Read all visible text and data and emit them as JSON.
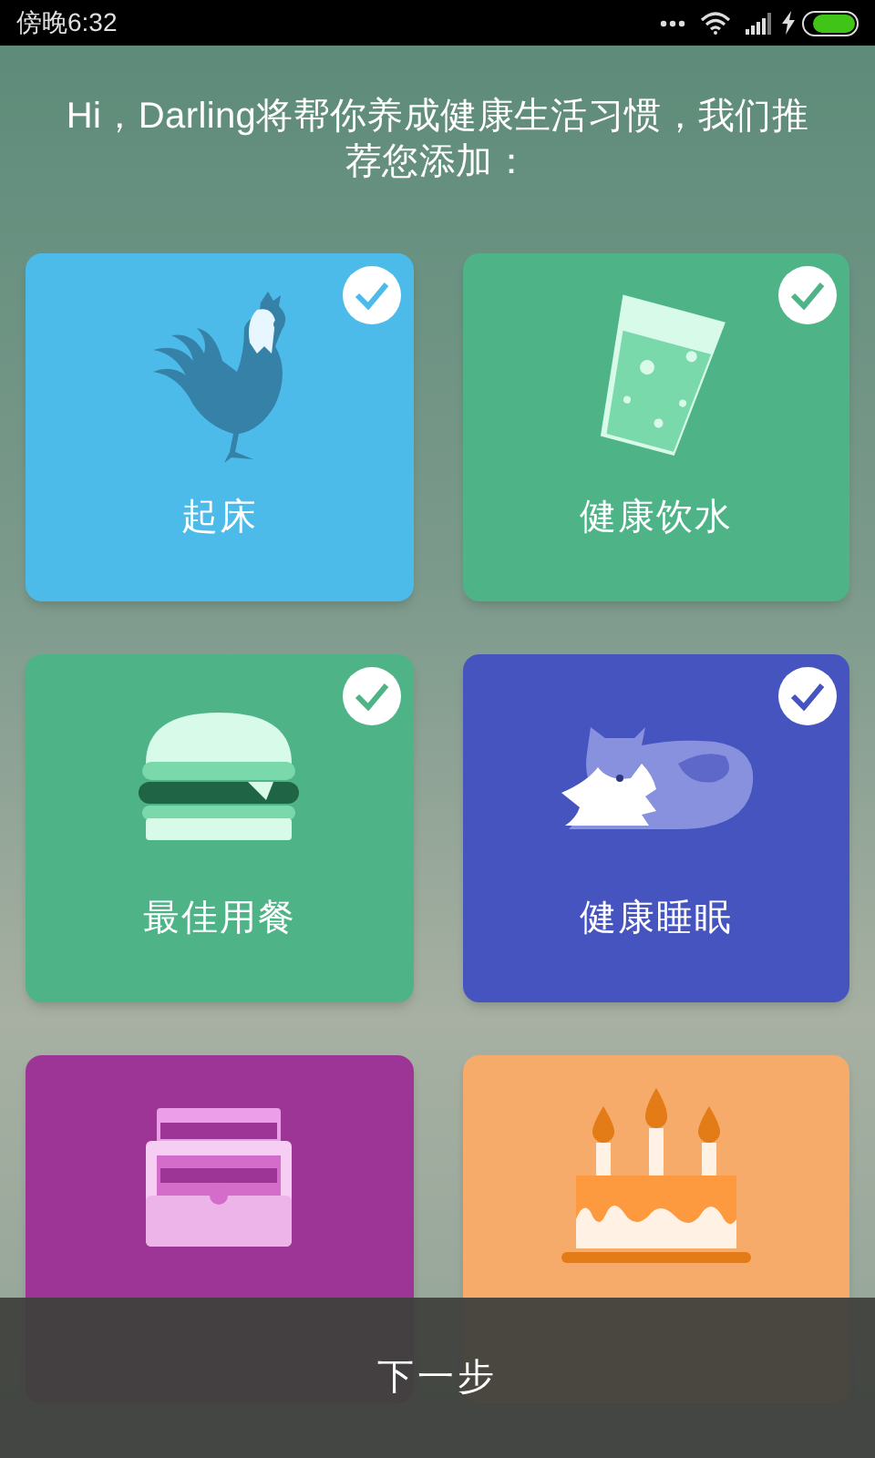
{
  "status_bar": {
    "time": "傍晚6:32",
    "charging": true,
    "battery": {
      "level": 0.85
    }
  },
  "greeting": "Hi，Darling将帮你养成健康生活习惯，我们推荐您添加：",
  "habits": [
    {
      "kind": "rooster",
      "label": "起床",
      "color": "#4dbbe9",
      "checked": true
    },
    {
      "kind": "glass",
      "label": "健康饮水",
      "color": "#4fb388",
      "checked": true
    },
    {
      "kind": "burger",
      "label": "最佳用餐",
      "color": "#4fb388",
      "checked": true
    },
    {
      "kind": "fox",
      "label": "健康睡眠",
      "color": "#4654c0",
      "checked": true
    },
    {
      "kind": "drawer",
      "color": "#9c3595",
      "checked": false
    },
    {
      "kind": "cake",
      "color": "#f6ab6b",
      "checked": false
    }
  ],
  "next_button": "下一步"
}
